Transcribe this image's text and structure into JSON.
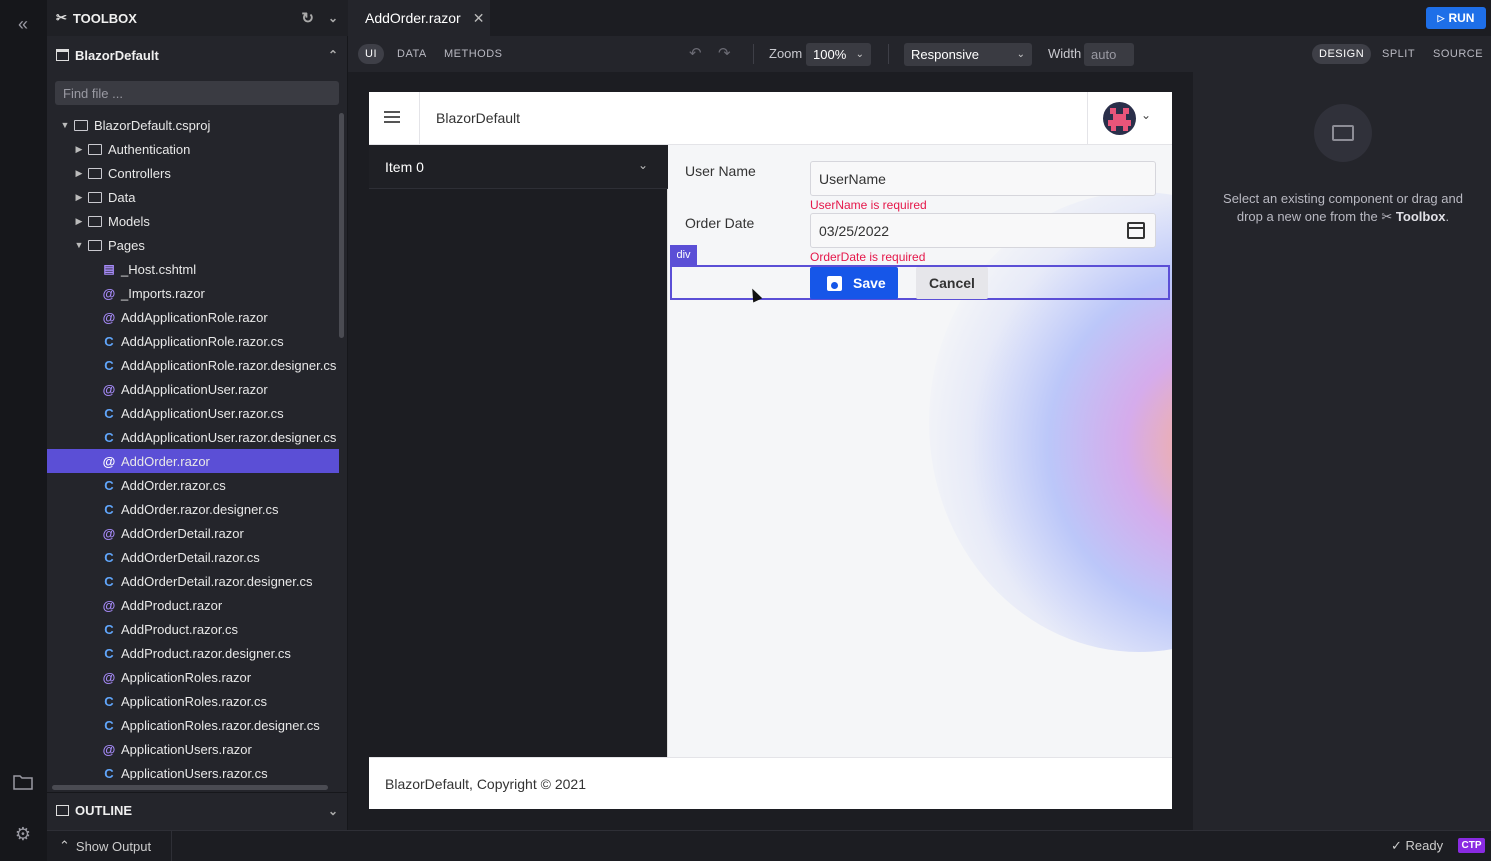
{
  "toolbox": {
    "title": "TOOLBOX"
  },
  "project": {
    "name": "BlazorDefault",
    "find_placeholder": "Find file ..."
  },
  "tree": [
    {
      "label": "BlazorDefault.csproj",
      "kind": "folder",
      "depth": 0,
      "expanded": true
    },
    {
      "label": "Authentication",
      "kind": "folder",
      "depth": 1,
      "expanded": false
    },
    {
      "label": "Controllers",
      "kind": "folder",
      "depth": 1,
      "expanded": false
    },
    {
      "label": "Data",
      "kind": "folder",
      "depth": 1,
      "expanded": false
    },
    {
      "label": "Models",
      "kind": "folder",
      "depth": 1,
      "expanded": false
    },
    {
      "label": "Pages",
      "kind": "folder",
      "depth": 1,
      "expanded": true
    },
    {
      "label": "_Host.cshtml",
      "kind": "doc",
      "depth": 2
    },
    {
      "label": "_Imports.razor",
      "kind": "at",
      "depth": 2
    },
    {
      "label": "AddApplicationRole.razor",
      "kind": "at",
      "depth": 2
    },
    {
      "label": "AddApplicationRole.razor.cs",
      "kind": "cs",
      "depth": 2
    },
    {
      "label": "AddApplicationRole.razor.designer.cs",
      "kind": "cs",
      "depth": 2
    },
    {
      "label": "AddApplicationUser.razor",
      "kind": "at",
      "depth": 2
    },
    {
      "label": "AddApplicationUser.razor.cs",
      "kind": "cs",
      "depth": 2
    },
    {
      "label": "AddApplicationUser.razor.designer.cs",
      "kind": "cs",
      "depth": 2
    },
    {
      "label": "AddOrder.razor",
      "kind": "at",
      "depth": 2,
      "selected": true
    },
    {
      "label": "AddOrder.razor.cs",
      "kind": "cs",
      "depth": 2
    },
    {
      "label": "AddOrder.razor.designer.cs",
      "kind": "cs",
      "depth": 2
    },
    {
      "label": "AddOrderDetail.razor",
      "kind": "at",
      "depth": 2
    },
    {
      "label": "AddOrderDetail.razor.cs",
      "kind": "cs",
      "depth": 2
    },
    {
      "label": "AddOrderDetail.razor.designer.cs",
      "kind": "cs",
      "depth": 2
    },
    {
      "label": "AddProduct.razor",
      "kind": "at",
      "depth": 2
    },
    {
      "label": "AddProduct.razor.cs",
      "kind": "cs",
      "depth": 2
    },
    {
      "label": "AddProduct.razor.designer.cs",
      "kind": "cs",
      "depth": 2
    },
    {
      "label": "ApplicationRoles.razor",
      "kind": "at",
      "depth": 2
    },
    {
      "label": "ApplicationRoles.razor.cs",
      "kind": "cs",
      "depth": 2
    },
    {
      "label": "ApplicationRoles.razor.designer.cs",
      "kind": "cs",
      "depth": 2
    },
    {
      "label": "ApplicationUsers.razor",
      "kind": "at",
      "depth": 2
    },
    {
      "label": "ApplicationUsers.razor.cs",
      "kind": "cs",
      "depth": 2
    }
  ],
  "outline": {
    "title": "OUTLINE"
  },
  "editor": {
    "tab_label": "AddOrder.razor",
    "run_label": "RUN"
  },
  "toolbar": {
    "modes": [
      "UI",
      "DATA",
      "METHODS"
    ],
    "active_mode": "UI",
    "zoom_label": "Zoom",
    "zoom_value": "100%",
    "layout_value": "Responsive",
    "width_label": "Width",
    "width_value": "auto",
    "views": [
      "DESIGN",
      "SPLIT",
      "SOURCE"
    ],
    "active_view": "DESIGN"
  },
  "preview": {
    "app_title": "BlazorDefault",
    "nav_item": "Item 0",
    "fields": {
      "username_label": "User Name",
      "username_value": "UserName",
      "username_error": "UserName is required",
      "orderdate_label": "Order Date",
      "orderdate_value": "03/25/2022",
      "orderdate_error": "OrderDate is required"
    },
    "selection_tag": "div",
    "save_label": "Save",
    "cancel_label": "Cancel",
    "footer": "BlazorDefault, Copyright © 2021"
  },
  "properties": {
    "hint_prefix": "Select an existing component or drag and drop a new one from the",
    "hint_tool": "Toolbox",
    "hint_suffix": "."
  },
  "status": {
    "show_output": "Show Output",
    "ready": "Ready",
    "badge": "CTP"
  },
  "colors": {
    "accent": "#5b4fd6",
    "run": "#1e6fe8",
    "save": "#1656e8",
    "error": "#e5174a"
  }
}
